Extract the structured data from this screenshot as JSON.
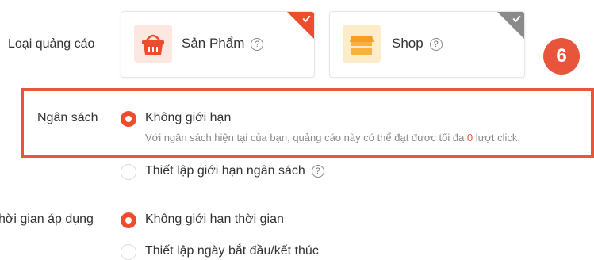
{
  "ad_type": {
    "label": "Loại quảng cáo",
    "options": [
      {
        "label": "Sản Phẩm",
        "help": "?",
        "selected": true,
        "icon": "shopping-basket-icon"
      },
      {
        "label": "Shop",
        "help": "?",
        "selected": false,
        "icon": "storefront-icon"
      }
    ]
  },
  "budget": {
    "label": "Ngân sách",
    "options": [
      {
        "label": "Không giới hạn",
        "selected": true,
        "hint_prefix": "Với ngân sách hiện tại của bạn, quảng cáo này có thể đạt được tối đa ",
        "hint_value": "0",
        "hint_suffix": " lượt click."
      },
      {
        "label": "Thiết lập giới hạn ngân sách",
        "help": "?",
        "selected": false
      }
    ]
  },
  "time": {
    "label": "hời gian áp dụng",
    "options": [
      {
        "label": "Không giới hạn thời gian",
        "selected": true
      },
      {
        "label": "Thiết lập ngày bắt đầu/kết thúc",
        "selected": false
      }
    ]
  },
  "annotation": {
    "step_badge": "6"
  },
  "colors": {
    "accent": "#ee4d2d",
    "highlight": "#e8553a",
    "muted": "#8a8a8a"
  }
}
